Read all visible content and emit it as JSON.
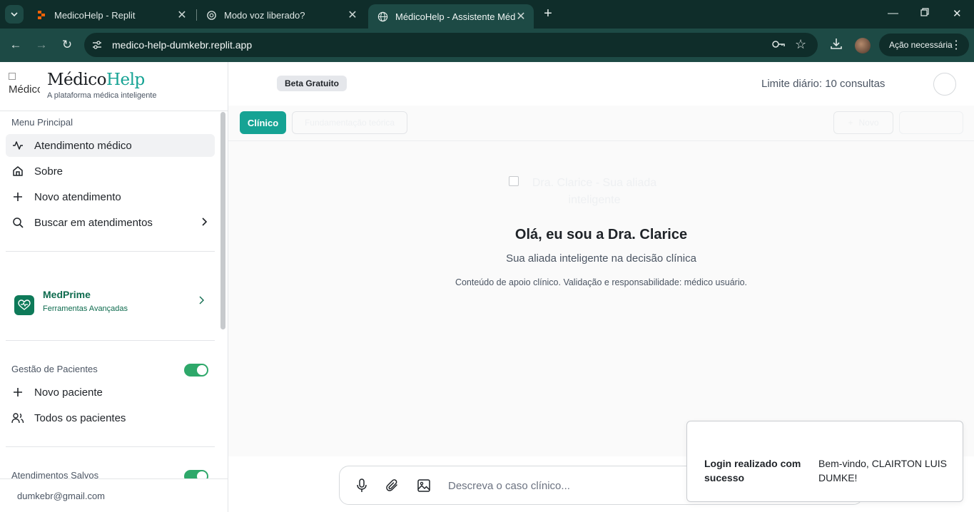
{
  "browser": {
    "tabs": [
      {
        "title": "MedicoHelp - Replit",
        "icon": "replit-icon"
      },
      {
        "title": "Modo voz liberado?",
        "icon": "openai-icon"
      },
      {
        "title": "MédicoHelp - Assistente Médico",
        "icon": "globe-icon",
        "active": true
      }
    ],
    "url": "medico-help-dumkebr.replit.app",
    "action_label": "Ação necessária"
  },
  "sidebar": {
    "logo_alt": "Médico",
    "brand_name_part1": "Médico",
    "brand_name_part2": "Help",
    "brand_tagline": "A plataforma médica inteligente",
    "menu_label": "Menu Principal",
    "menu": [
      {
        "label": "Atendimento médico",
        "icon": "activity-icon",
        "active": true
      },
      {
        "label": "Sobre",
        "icon": "home-icon"
      },
      {
        "label": "Novo atendimento",
        "icon": "plus-icon"
      },
      {
        "label": "Buscar em atendimentos",
        "icon": "search-icon"
      }
    ],
    "medprime": {
      "title": "MedPrime",
      "subtitle": "Ferramentas Avançadas"
    },
    "patients": {
      "label": "Gestão de Pacientes",
      "toggle_on": true,
      "items": [
        {
          "label": "Novo paciente",
          "icon": "plus-icon"
        },
        {
          "label": "Todos os pacientes",
          "icon": "users-icon"
        }
      ]
    },
    "saved": {
      "label": "Atendimentos Salvos",
      "toggle_on": true
    },
    "user_email": "dumkebr@gmail.com"
  },
  "main": {
    "beta_badge": "Beta Gratuito",
    "daily_limit": "Limite diário: 10 consultas",
    "modes": {
      "clinico": "Clínico",
      "fundamentacao": "Fundamentação teórica"
    },
    "new_button": "Novo",
    "hero": {
      "image_alt": "Dra. Clarice - Sua aliada inteligente",
      "title": "Olá, eu sou a Dra. Clarice",
      "subtitle": "Sua aliada inteligente na decisão clínica",
      "note": "Conteúdo de apoio clínico. Validação e responsabilidade: médico usuário."
    },
    "composer": {
      "placeholder": "Descreva o caso clínico..."
    }
  },
  "toast": {
    "title": "Login realizado com sucesso",
    "message": "Bem-vindo, CLAIRTON LUIS DUMKE!"
  },
  "colors": {
    "accent": "#16a394",
    "brand_dark": "#0f2d2a",
    "medprime_green": "#0e7a59",
    "toggle_green": "#2ea86a"
  }
}
